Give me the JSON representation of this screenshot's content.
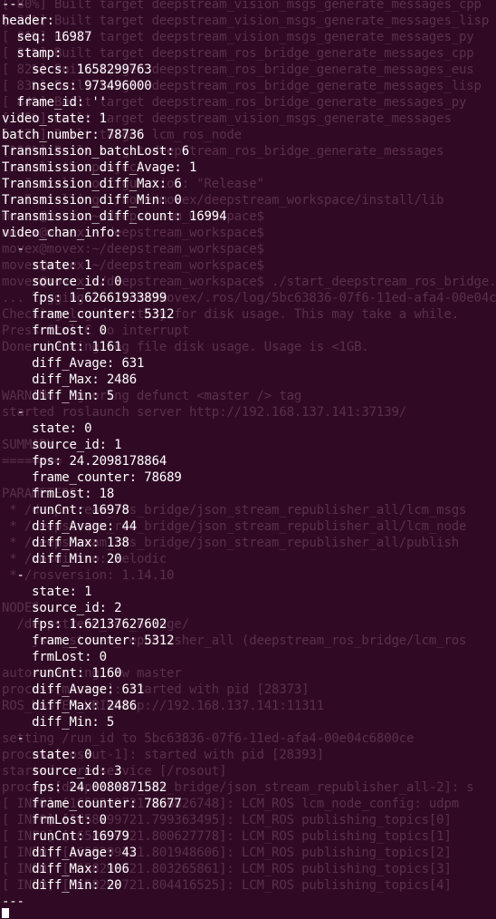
{
  "terminal": {
    "foreground_lines": [
      "---",
      "header:",
      "  seq: 16987",
      "  stamp:",
      "    secs: 1658299763",
      "    nsecs: 973496000",
      "  frame_id: ''",
      "video_state: 1",
      "batch_number: 78736",
      "Transmission_batchLost: 6",
      "Transmission_diff_Avage: 1",
      "Transmission_diff_Max: 6",
      "Transmission_diff_Min: 0",
      "Transmission_diff_count: 16994",
      "video_chan_info:",
      "  -",
      "    state: 1",
      "    source_id: 0",
      "    fps: 1.62661933899",
      "    frame_counter: 5312",
      "    frmLost: 0",
      "    runCnt: 1161",
      "    diff_Avage: 631",
      "    diff_Max: 2486",
      "    diff_Min: 5",
      "  -",
      "    state: 0",
      "    source_id: 1",
      "    fps: 24.2098178864",
      "    frame_counter: 78689",
      "    frmLost: 18",
      "    runCnt: 16978",
      "    diff_Avage: 44",
      "    diff_Max: 138",
      "    diff_Min: 20",
      "  -",
      "    state: 1",
      "    source_id: 2",
      "    fps: 1.62137627602",
      "    frame_counter: 5312",
      "    frmLost: 0",
      "    runCnt: 1160",
      "    diff_Avage: 631",
      "    diff_Max: 2486",
      "    diff_Min: 5",
      "  -",
      "    state: 0",
      "    source_id: 3",
      "    fps: 24.0080871582",
      "    frame_counter: 78677",
      "    frmLost: 0",
      "    runCnt: 16979",
      "    diff_Avage: 43",
      "    diff_Max: 106",
      "    diff_Min: 20",
      "---"
    ],
    "background_lines": [
      "[ 80%] Built target deepstream_vision_msgs_generate_messages_cpp",
      "[ 80%] Built target deepstream_vision_msgs_generate_messages_lisp",
      "[ 81%] Built target deepstream_vision_msgs_generate_messages_py",
      "[ 81%] Built target deepstream_ros_bridge_generate_messages_cpp",
      "[ 82%] Built target deepstream_ros_bridge_generate_messages_eus",
      "[ 83%] Built target deepstream_ros_bridge_generate_messages_lisp",
      "[ 84%] Built target deepstream_ros_bridge_generate_messages_py",
      "[ 85%] Built target deepstream_vision_msgs_generate_messages",
      "[ 87%] Built target lcm_ros_node",
      "[100%] Built target deepstream_ros_bridge_generate_messages",
      "Install the project...",
      "-- Install configuration: \"Release\"",
      "-- Installing: /home/movex/deepstream_workspace/install/lib",
      "movex@movex:~/deepstream_workspace$",
      "movex@movex:~/deepstream_workspace$",
      "movex@movex:~/deepstream_workspace$",
      "movex@movex:~/deepstream_workspace$",
      "movex@movex:~/deepstream_workspace$ ./start_deepstream_ros_bridge.sh",
      "... logging to /home/movex/.ros/log/5bc63836-07f6-11ed-afa4-00e04c6800ce",
      "Checking log directory for disk usage. This may take a while.",
      "Press Ctrl-C to interrupt",
      "Done checking log file disk usage. Usage is <1GB.",
      "",
      "",
      "WARNING: ignoring defunct <master /> tag",
      "started roslaunch server http://192.168.137.141:37139/",
      "",
      "SUMMARY",
      "========",
      "",
      "PARAMETERS",
      " * /deepstream_ros_bridge/json_stream_republisher_all/lcm_msgs",
      " * /deepstream_ros_bridge/json_stream_republisher_all/lcm_node",
      " * /deepstream_ros_bridge/json_stream_republisher_all/publish",
      " * /rosdistro: melodic",
      " * /rosversion: 1.14.10",
      "",
      "NODES",
      "  /deepstream_ros_bridge/",
      "    json_stream_republisher_all (deepstream_ros_bridge/lcm_ros",
      "",
      "auto-starting new master",
      "process[master]: started with pid [28373]",
      "ROS_MASTER_URI=http://192.168.137.141:11311",
      "",
      "setting /run_id to 5bc63836-07f6-11ed-afa4-00e04c6800ce",
      "process[rosout-1]: started with pid [28393]",
      "started core service [/rosout]",
      "process[deepstream_ros_bridge/json_stream_republisher_all-2]: s",
      "[ INFO] [1658299721.796826748]: LCM_ROS lcm_node_config: udpm",
      "[ INFO] [1658299721.799363495]: LCM_ROS publishing_topics[0]",
      "[ INFO] [1658299721.800627778]: LCM_ROS publishing_topics[1]",
      "[ INFO] [1658299721.801948606]: LCM_ROS publishing_topics[2]",
      "[ INFO] [1658299721.803265861]: LCM_ROS publishing_topics[3]",
      "[ INFO] [1658299721.804416525]: LCM_ROS publishing_topics[4]"
    ]
  }
}
